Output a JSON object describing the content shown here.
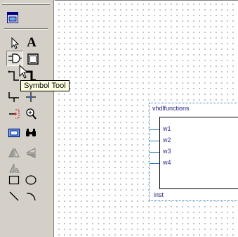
{
  "toolbar": {
    "tools": [
      {
        "name": "floating-window-icon"
      },
      {
        "name": "selection-tool-icon"
      },
      {
        "name": "text-tool-icon",
        "glyph": "A"
      },
      {
        "name": "symbol-tool-icon"
      },
      {
        "name": "block-tool-icon"
      },
      {
        "name": "orthogonal-node-tool-icon"
      },
      {
        "name": "orthogonal-bus-tool-icon"
      },
      {
        "name": "conduit-tool-icon"
      },
      {
        "name": "zoom-tool-icon"
      },
      {
        "name": "full-screen-icon"
      },
      {
        "name": "find-icon"
      },
      {
        "name": "flip-horizontal-icon"
      },
      {
        "name": "flip-vertical-icon"
      },
      {
        "name": "rotate-icon"
      },
      {
        "name": "rectangle-tool-icon"
      },
      {
        "name": "oval-tool-icon"
      },
      {
        "name": "line-tool-icon"
      },
      {
        "name": "arc-tool-icon"
      }
    ]
  },
  "tooltip": {
    "text": "Symbol Tool"
  },
  "symbol": {
    "title": "vhdlfunctions",
    "pins": [
      "w1",
      "w2",
      "w3",
      "w4"
    ],
    "instance": "inst"
  },
  "colors": {
    "toolbar_bg": "#d4d0c8",
    "tooltip_bg": "#ffffe1",
    "pin_color": "#2f7fbf"
  }
}
